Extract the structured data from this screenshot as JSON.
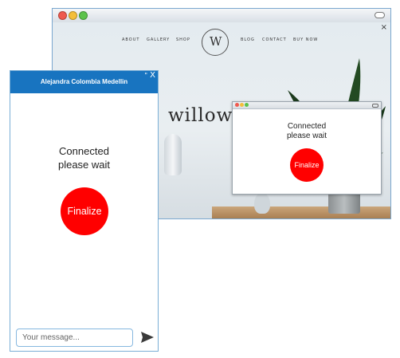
{
  "browser": {
    "traffic_lights": [
      "close",
      "minimize",
      "maximize"
    ],
    "close_glyph": "×"
  },
  "site": {
    "nav_left": [
      "ABOUT",
      "GALLERY",
      "SHOP"
    ],
    "nav_right": [
      "BLOG",
      "CONTACT",
      "BUY NOW"
    ],
    "logo_letter": "W",
    "logo_ring_text": "WILLOW STUDIO",
    "headline": "willow st"
  },
  "mini_popup": {
    "status_line1": "Connected",
    "status_line2": "please wait",
    "finalize_label": "Finalize"
  },
  "chat": {
    "title": "Alejandra Colombia Medellin",
    "minimize_glyph": "\"",
    "close_glyph": "X",
    "status_line1": "Connected",
    "status_line2": "please wait",
    "finalize_label": "Finalize",
    "input_placeholder": "Your message...",
    "send_icon": "send-arrow-icon"
  },
  "colors": {
    "header_blue": "#1874c0",
    "finalize_red": "#ff0000",
    "window_border": "#7aa7cf"
  }
}
